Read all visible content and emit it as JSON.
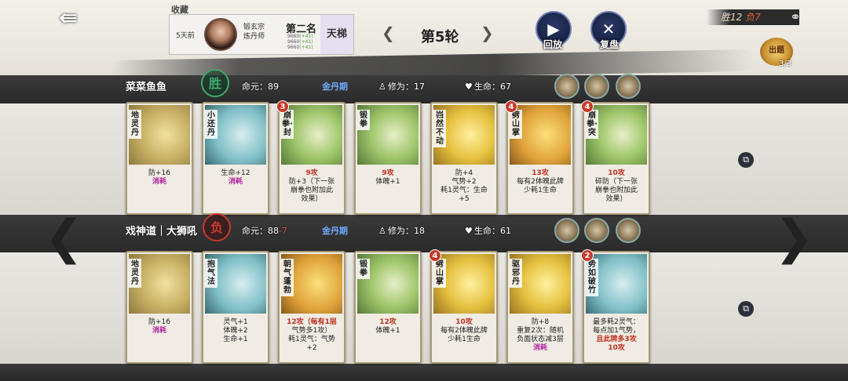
{
  "header": {
    "collection_tag": "收藏",
    "time_ago": "5天前",
    "sect_line1": "锻玄宗",
    "sect_line2": "炼丹师",
    "rank": "第二名",
    "stat1": "9660",
    "stat1_delta": "(+41)",
    "stat2": "9660",
    "stat2_delta": "(+41)",
    "stat3": "9660",
    "stat3_delta": "(+41)",
    "ladder": "天梯",
    "round": "第5轮",
    "replay_label": "回放",
    "review_label": "复盘",
    "wins": "胜12",
    "losses": "负7",
    "tournament": "出题",
    "tournament_count": "3/3"
  },
  "players": [
    {
      "name": "菜菜鱼鱼",
      "result": "胜",
      "life_label": "命元：",
      "life_value": "89",
      "life_delta": "",
      "realm": "金丹期",
      "cultivation_label": "修为：",
      "cultivation": "17",
      "hp_label": "生命：",
      "hp": "67",
      "cards": [
        {
          "name": "地灵丹",
          "level": "",
          "lines": [
            "防+16"
          ],
          "consume": "消耗"
        },
        {
          "name": "小还丹",
          "level": "",
          "lines": [
            "生命+12"
          ],
          "consume": "消耗"
        },
        {
          "name": "崩拳·封",
          "level": "3",
          "lines": [
            "9攻",
            "防+3（下一张",
            "崩拳也附加此",
            "效果）"
          ],
          "consume": ""
        },
        {
          "name": "锻拳",
          "level": "",
          "lines": [
            "9攻",
            "体魄+1"
          ],
          "consume": ""
        },
        {
          "name": "岿然不动",
          "level": "",
          "lines": [
            "防+4",
            "气势+2",
            "耗1灵气：生命",
            "+5"
          ],
          "consume": ""
        },
        {
          "name": "劈山掌",
          "level": "4",
          "lines": [
            "13攻",
            "每有2体魄此牌",
            "少耗1生命"
          ],
          "consume": ""
        },
        {
          "name": "崩拳·突",
          "level": "4",
          "lines": [
            "10攻",
            "碎防（下一张",
            "崩拳也附加此",
            "效果）"
          ],
          "consume": ""
        }
      ]
    },
    {
      "name": "戏神道｜大狮吼",
      "result": "负",
      "life_label": "命元：",
      "life_value": "88",
      "life_delta": "-7",
      "realm": "金丹期",
      "cultivation_label": "修为：",
      "cultivation": "18",
      "hp_label": "生命：",
      "hp": "61",
      "cards": [
        {
          "name": "地灵丹",
          "level": "",
          "lines": [
            "防+16"
          ],
          "consume": "消耗"
        },
        {
          "name": "抱气法",
          "level": "",
          "lines": [
            "灵气+1",
            "体魄+2",
            "生命+1"
          ],
          "consume": ""
        },
        {
          "name": "朝气蓬勃",
          "level": "",
          "lines": [
            "12攻（每有1层",
            "气势多1攻）",
            "耗1灵气：气势",
            "+2"
          ],
          "consume": ""
        },
        {
          "name": "锻拳",
          "level": "",
          "lines": [
            "12攻",
            "体魄+1"
          ],
          "consume": ""
        },
        {
          "name": "劈山掌",
          "level": "4",
          "lines": [
            "10攻",
            "每有2体魄此牌",
            "少耗1生命"
          ],
          "consume": ""
        },
        {
          "name": "驱邪丹",
          "level": "",
          "lines": [
            "防+8",
            "重复2次：随机",
            "负面状态减3层"
          ],
          "consume": "消耗"
        },
        {
          "name": "势如破竹",
          "level": "2",
          "lines": [
            "最多耗2灵气：",
            "每点加1气势，",
            "且此牌多3攻",
            "10攻"
          ],
          "consume": ""
        }
      ]
    }
  ],
  "icons": {
    "back": "back-arrow-icon",
    "replay": "play-icon",
    "review": "crossed-swords-icon",
    "share": "share-icon",
    "copy": "copy-icon",
    "prev": "chevron-left-icon",
    "next": "chevron-right-icon"
  },
  "colors": {
    "win": "#3ea870",
    "lose": "#c03a30",
    "realm": "#6fa8ff",
    "attack": "#c03020",
    "consume": "#b0209a"
  }
}
